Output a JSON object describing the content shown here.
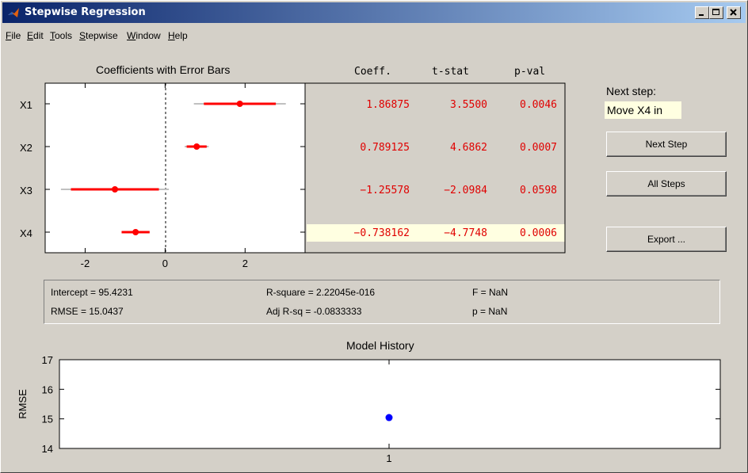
{
  "window": {
    "title": "Stepwise Regression",
    "buttons": [
      "minimize",
      "maximize",
      "close"
    ]
  },
  "menu": [
    {
      "label": "File",
      "u": "F",
      "rest": "ile"
    },
    {
      "label": "Edit",
      "u": "E",
      "rest": "dit"
    },
    {
      "label": "Tools",
      "u": "T",
      "rest": "ools"
    },
    {
      "label": "Stepwise",
      "u": "S",
      "rest": "tepwise"
    },
    {
      "label": "Window",
      "u": "W",
      "rest": "indow"
    },
    {
      "label": "Help",
      "u": "H",
      "rest": "elp"
    }
  ],
  "coef_plot": {
    "title": "Coefficients with Error Bars",
    "xlim": [
      -3,
      3.5
    ],
    "xticks": [
      "-2",
      "0",
      "2"
    ],
    "colors": {
      "in_model": "#ff0000",
      "ci_outer": "#c0c0c0"
    }
  },
  "table": {
    "headers": [
      "Coeff.",
      "t-stat",
      "p-val"
    ],
    "rows": [
      {
        "name": "X1",
        "coeff": "1.86875",
        "tstat": "3.5500",
        "pval": "0.0046",
        "highlight": false
      },
      {
        "name": "X2",
        "coeff": "0.789125",
        "tstat": "4.6862",
        "pval": "0.0007",
        "highlight": false
      },
      {
        "name": "X3",
        "coeff": "−1.25578",
        "tstat": "−2.0984",
        "pval": "0.0598",
        "highlight": false
      },
      {
        "name": "X4",
        "coeff": "−0.738162",
        "tstat": "−4.7748",
        "pval": "0.0006",
        "highlight": true
      }
    ]
  },
  "next_step": {
    "label": "Next step:",
    "value": "Move X4 in"
  },
  "buttons": {
    "next_step": "Next Step",
    "all_steps": "All Steps",
    "export": "Export ..."
  },
  "stats": {
    "intercept": "Intercept = 95.4231",
    "rmse": "RMSE = 15.0437",
    "rsquare": "R-square = 2.22045e-016",
    "adj_rsq": "Adj R-sq = -0.0833333",
    "f": "F = NaN",
    "p": "p = NaN"
  },
  "chart_data": {
    "type": "scatter",
    "title": "Model History",
    "ylabel": "RMSE",
    "xlabel": "",
    "x": [
      1
    ],
    "y": [
      15.0437
    ],
    "ylim": [
      14,
      17
    ],
    "yticks": [
      "14",
      "15",
      "16",
      "17"
    ],
    "xticks": [
      "1"
    ],
    "color": "#0000ff"
  }
}
